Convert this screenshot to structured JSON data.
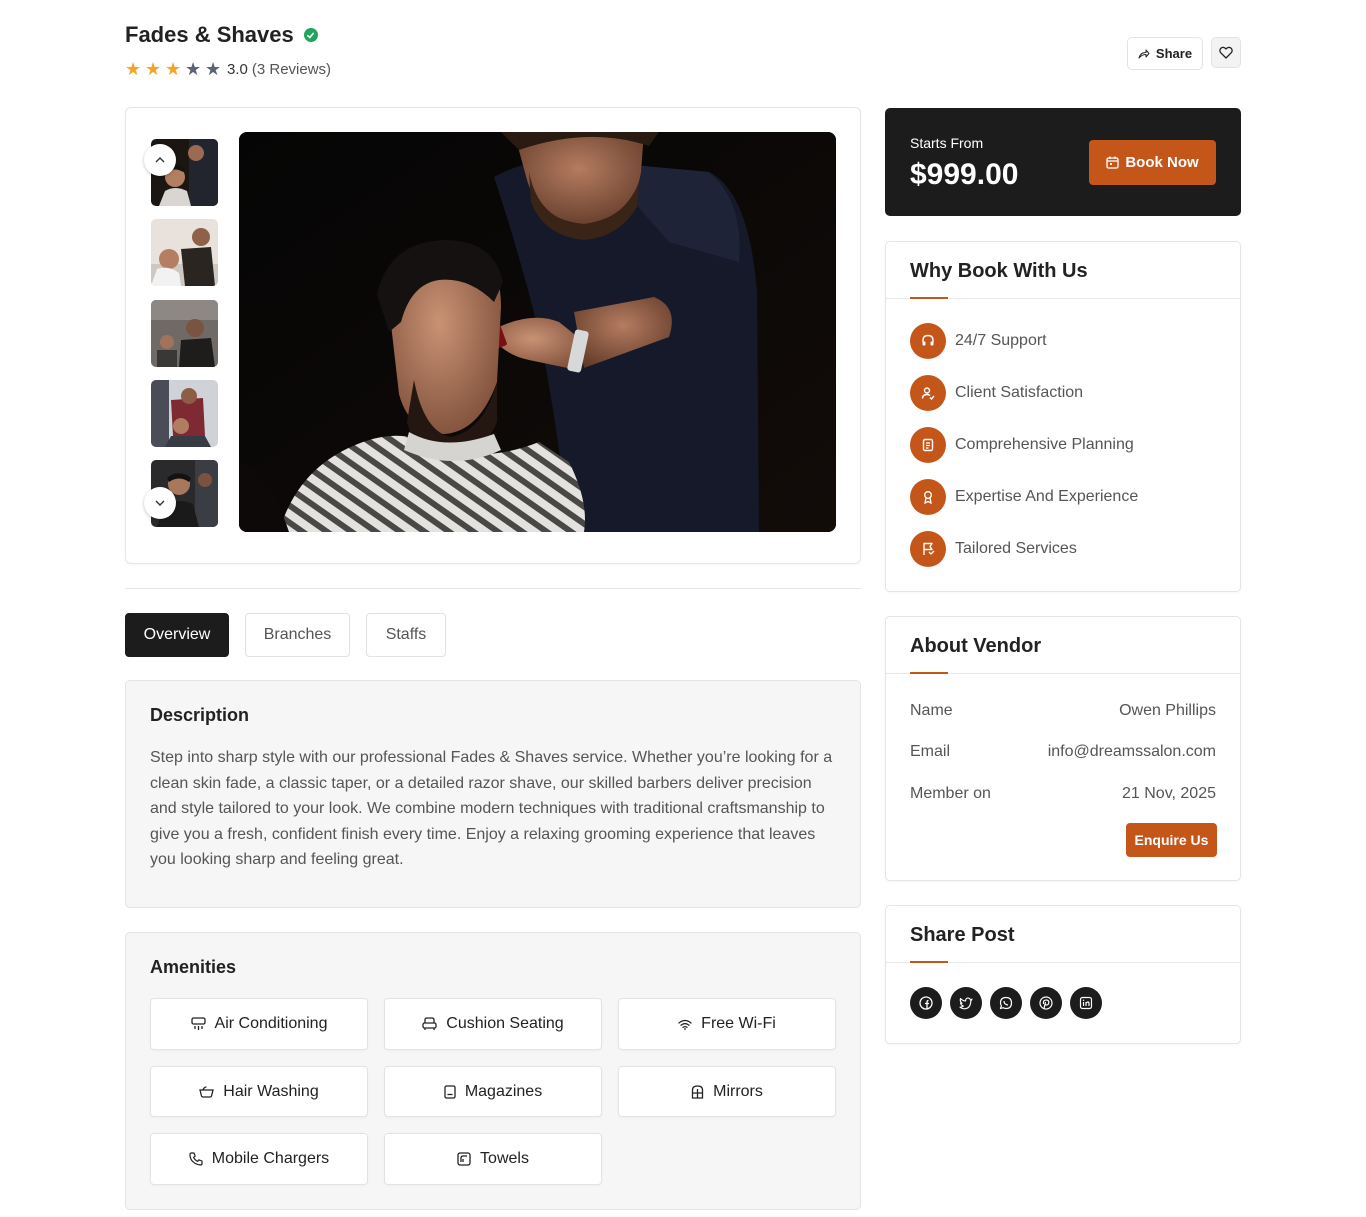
{
  "header": {
    "title": "Fades & Shaves",
    "rating": {
      "value": "3.0",
      "reviews": "(3 Reviews)",
      "stars": 3,
      "max": 5
    },
    "share_label": "Share"
  },
  "gallery": {
    "thumbnail_count": 5
  },
  "tabs": [
    {
      "label": "Overview",
      "active": true
    },
    {
      "label": "Branches",
      "active": false
    },
    {
      "label": "Staffs",
      "active": false
    }
  ],
  "description": {
    "heading": "Description",
    "text": "Step into sharp style with our professional Fades & Shaves service. Whether you’re looking for a clean skin fade, a classic taper, or a detailed razor shave, our skilled barbers deliver precision and style tailored to your look. We combine modern techniques with traditional craftsmanship to give you a fresh, confident finish every time. Enjoy a relaxing grooming experience that leaves you looking sharp and feeling great."
  },
  "amenities": {
    "heading": "Amenities",
    "items": [
      {
        "label": "Air Conditioning",
        "icon": "air-conditioner-icon"
      },
      {
        "label": "Cushion Seating",
        "icon": "armchair-icon"
      },
      {
        "label": "Free Wi-Fi",
        "icon": "wifi-icon"
      },
      {
        "label": "Hair Washing",
        "icon": "wash-basin-icon"
      },
      {
        "label": "Magazines",
        "icon": "book-icon"
      },
      {
        "label": "Mirrors",
        "icon": "mirror-icon"
      },
      {
        "label": "Mobile Chargers",
        "icon": "phone-icon"
      },
      {
        "label": "Towels",
        "icon": "towel-icon"
      }
    ]
  },
  "pricing": {
    "label": "Starts From",
    "amount": "$999.00",
    "book_label": "Book Now"
  },
  "why_book": {
    "heading": "Why Book With Us",
    "items": [
      {
        "label": "24/7 Support",
        "icon": "headset-icon"
      },
      {
        "label": "Client Satisfaction",
        "icon": "user-check-icon"
      },
      {
        "label": "Comprehensive Planning",
        "icon": "planner-icon"
      },
      {
        "label": "Expertise And Experience",
        "icon": "award-icon"
      },
      {
        "label": "Tailored Services",
        "icon": "flag-icon"
      }
    ]
  },
  "vendor": {
    "heading": "About Vendor",
    "rows": [
      {
        "label": "Name",
        "value": "Owen Phillips"
      },
      {
        "label": "Email",
        "value": "info@dreamssalon.com"
      },
      {
        "label": "Member on",
        "value": "21 Nov, 2025"
      }
    ],
    "enquire_label": "Enquire Us"
  },
  "share_post": {
    "heading": "Share Post",
    "networks": [
      "facebook-icon",
      "twitter-icon",
      "whatsapp-icon",
      "pinterest-icon",
      "linkedin-icon"
    ]
  },
  "colors": {
    "accent": "#c4561a",
    "dark": "#1c1c1c",
    "star": "#f5a524",
    "verified": "#22a55a"
  }
}
